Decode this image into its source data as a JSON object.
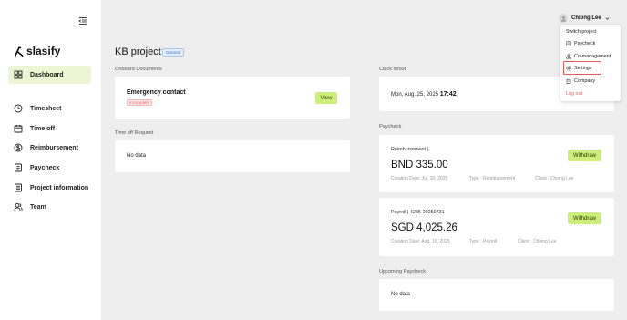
{
  "brand": {
    "name": "slasify"
  },
  "sidebar": {
    "items": [
      {
        "label": "Dashboard"
      },
      {
        "label": "Timesheet"
      },
      {
        "label": "Time off"
      },
      {
        "label": "Reimbursement"
      },
      {
        "label": "Paycheck"
      },
      {
        "label": "Project information"
      },
      {
        "label": "Team"
      }
    ]
  },
  "header": {
    "title": "KB project",
    "tag": "General",
    "user_name": "Chiong Lee"
  },
  "user_menu": {
    "items": [
      {
        "label": "Switch project"
      },
      {
        "label": "Paycheck"
      },
      {
        "label": "Co-management"
      },
      {
        "label": "Settings"
      },
      {
        "label": "Company"
      },
      {
        "label": "Log out"
      }
    ]
  },
  "onboard": {
    "title": "Onboard Documents",
    "doc_name": "Emergency contact",
    "status": "Incomplete",
    "action": "View"
  },
  "timeoff": {
    "title": "Time off Request",
    "empty": "No data"
  },
  "clock": {
    "title": "Clock in/out",
    "date": "Mon, Aug. 25, 2025",
    "time": "17:42"
  },
  "paycheck": {
    "title": "Paycheck",
    "items": [
      {
        "name": "Reimbursement |",
        "amount": "BND 335.00",
        "action": "Withdraw",
        "creation": "Creation Date:  Jul. 30, 2025",
        "type": "Type :  Reimbursement",
        "client": "Client :  Chiong Lee"
      },
      {
        "name": "Payroll | 4285-20250731",
        "amount": "SGD 4,025.26",
        "action": "Withdraw",
        "creation": "Creation Date:  Aug. 10, 2025",
        "type": "Type :  Payroll",
        "client": "Client :  Chiong Lee"
      }
    ]
  },
  "upcoming": {
    "title": "Upcoming Paycheck",
    "empty": "No data"
  },
  "colors": {
    "accent": "#cdef7a",
    "active_nav": "#eef5d4",
    "danger": "#e35b5b",
    "background": "#eeeeee"
  }
}
